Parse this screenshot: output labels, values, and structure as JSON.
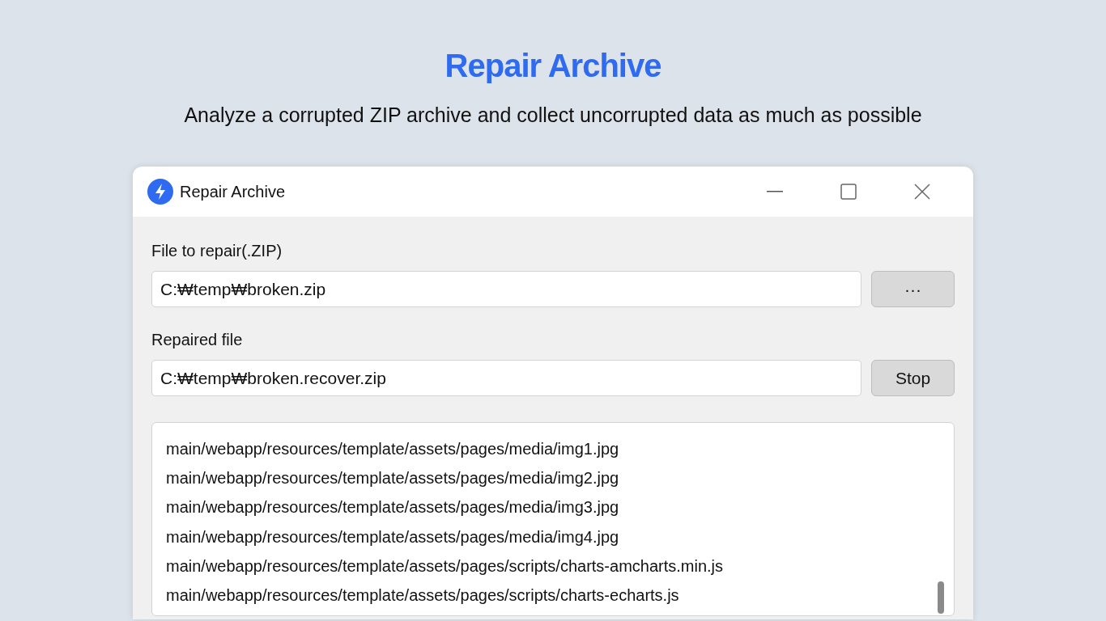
{
  "page": {
    "title": "Repair Archive",
    "subtitle": "Analyze a corrupted ZIP archive and collect uncorrupted data as much as possible"
  },
  "window": {
    "title": "Repair Archive"
  },
  "fields": [
    {
      "label": "File to repair(.ZIP)",
      "value": "C:₩temp₩broken.zip",
      "button": "···"
    },
    {
      "label": "Repaired file",
      "value": "C:₩temp₩broken.recover.zip",
      "button": "Stop"
    }
  ],
  "log": [
    "main/webapp/resources/template/assets/pages/media/img1.jpg",
    "main/webapp/resources/template/assets/pages/media/img2.jpg",
    "main/webapp/resources/template/assets/pages/media/img3.jpg",
    "main/webapp/resources/template/assets/pages/media/img4.jpg",
    "main/webapp/resources/template/assets/pages/scripts/charts-amcharts.min.js",
    "main/webapp/resources/template/assets/pages/scripts/charts-echarts.js"
  ]
}
